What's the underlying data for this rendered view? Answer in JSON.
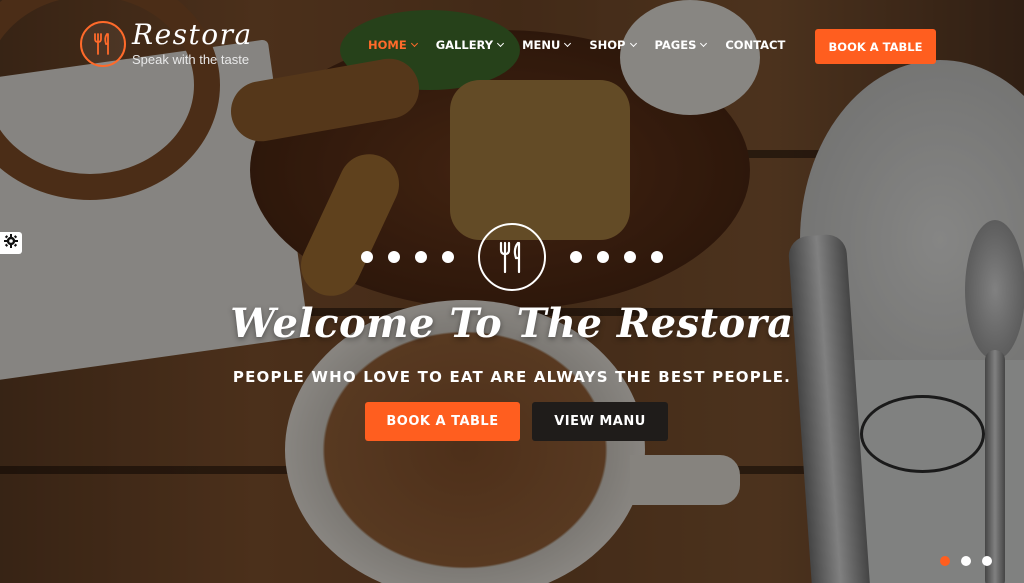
{
  "brand": {
    "name": "Restora",
    "tagline": "Speak with the taste",
    "accent_color": "#ff5e1f",
    "logo_icon": "fork-knife-icon"
  },
  "nav": {
    "items": [
      {
        "label": "HOME",
        "active": true,
        "has_dropdown": true
      },
      {
        "label": "GALLERY",
        "active": false,
        "has_dropdown": true
      },
      {
        "label": "MENU",
        "active": false,
        "has_dropdown": true
      },
      {
        "label": "SHOP",
        "active": false,
        "has_dropdown": true
      },
      {
        "label": "PAGES",
        "active": false,
        "has_dropdown": true
      },
      {
        "label": "CONTACT",
        "active": false,
        "has_dropdown": false
      }
    ],
    "cta_label": "BOOK A TABLE"
  },
  "settings": {
    "icon": "gear-icon"
  },
  "hero": {
    "emblem_icon": "fork-knife-icon",
    "title": "Welcome To The Restora",
    "subtitle": "PEOPLE WHO LOVE TO EAT ARE ALWAYS THE BEST PEOPLE.",
    "primary_button": "BOOK A TABLE",
    "secondary_button": "VIEW MANU"
  },
  "slider": {
    "count": 3,
    "active_index": 0
  }
}
